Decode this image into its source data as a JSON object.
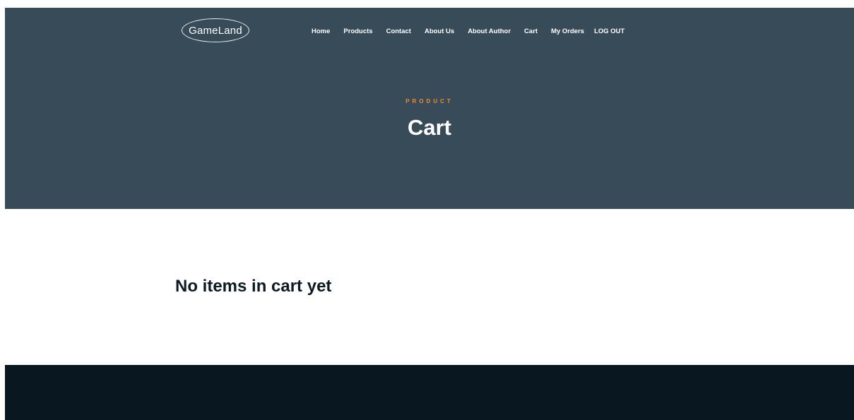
{
  "brand": {
    "logo_text": "GameLand"
  },
  "nav": {
    "items": [
      {
        "label": "Home"
      },
      {
        "label": "Products"
      },
      {
        "label": "Contact"
      },
      {
        "label": "About Us"
      },
      {
        "label": "About Author"
      },
      {
        "label": "Cart"
      },
      {
        "label": "My Orders"
      },
      {
        "label": "LOG OUT"
      }
    ]
  },
  "hero": {
    "eyebrow": "PRODUCT",
    "title": "Cart"
  },
  "cart": {
    "empty_message": "No items in cart yet"
  },
  "colors": {
    "hero_bg": "#384b58",
    "accent": "#f28a26",
    "footer_bg": "#081720",
    "heading_dark": "#0c1a24"
  }
}
